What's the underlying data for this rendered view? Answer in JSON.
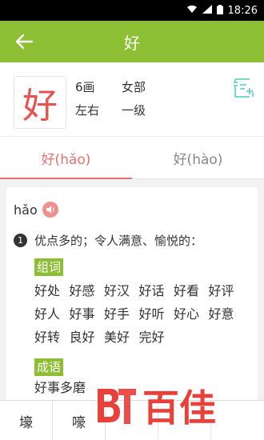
{
  "status_bar": {
    "time": "18:26"
  },
  "app_bar": {
    "title": "好"
  },
  "header": {
    "character": "好",
    "strokes": "6画",
    "radical": "女部",
    "structure": "左右",
    "level": "一级"
  },
  "tabs": [
    {
      "label": "好(hǎo)",
      "active": true
    },
    {
      "label": "好(hào)",
      "active": false
    }
  ],
  "content": {
    "pinyin": "hǎo",
    "definition_number": "1",
    "definition": "优点多的；令人满意、愉悦的：",
    "words_tag": "组词",
    "words": [
      "好处",
      "好感",
      "好汉",
      "好话",
      "好看",
      "好评",
      "好人",
      "好事",
      "好手",
      "好听",
      "好心",
      "好意",
      "好转",
      "良好",
      "美好",
      "完好"
    ],
    "idioms_tag": "成语",
    "idioms": [
      "好事多磨"
    ]
  },
  "bottom_bar": {
    "items": [
      "壕",
      "嚎",
      "",
      "",
      ""
    ]
  },
  "watermark": {
    "text": "百佳",
    "logo_text": "BT"
  },
  "colors": {
    "accent": "#8dbf34",
    "highlight": "#e8524f",
    "tab_active": "#e8726d"
  }
}
